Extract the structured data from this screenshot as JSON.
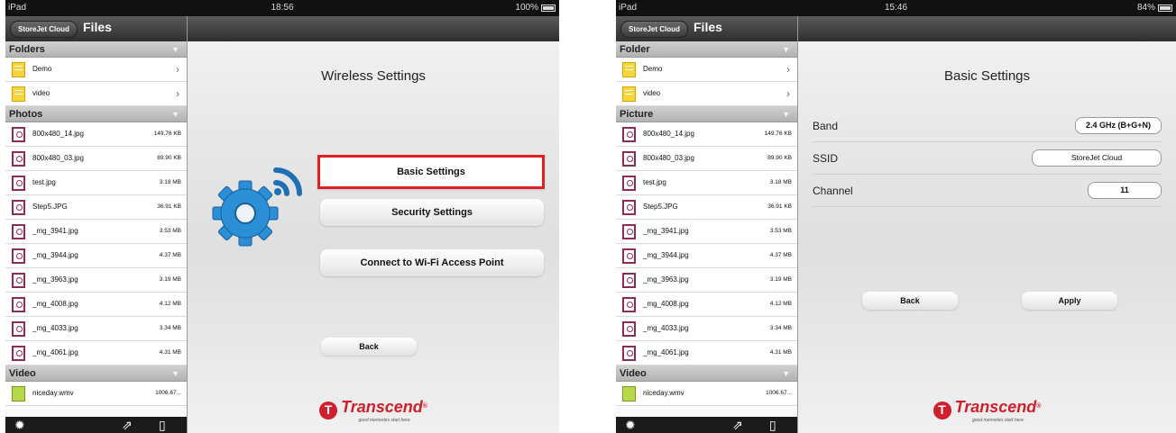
{
  "left": {
    "status": {
      "carrier": "iPad",
      "time": "18:56",
      "battery": "100%"
    },
    "sidebar": {
      "cloud_button": "StoreJet Cloud",
      "title": "Files",
      "folders_header": "Folders",
      "folders": [
        {
          "name": "Demo"
        },
        {
          "name": "video"
        }
      ],
      "photos_header": "Photos",
      "photos": [
        {
          "name": "800x480_14.jpg",
          "size": "149.76 KB"
        },
        {
          "name": "800x480_03.jpg",
          "size": "89.90 KB"
        },
        {
          "name": "test.jpg",
          "size": "3.18 MB"
        },
        {
          "name": "Step5.JPG",
          "size": "36.91 KB"
        },
        {
          "name": "_mg_3941.jpg",
          "size": "3.53 MB"
        },
        {
          "name": "_mg_3944.jpg",
          "size": "4.37 MB"
        },
        {
          "name": "_mg_3963.jpg",
          "size": "3.19 MB"
        },
        {
          "name": "_mg_4008.jpg",
          "size": "4.12 MB"
        },
        {
          "name": "_mg_4033.jpg",
          "size": "3.34 MB"
        },
        {
          "name": "_mg_4061.jpg",
          "size": "4.31 MB"
        }
      ],
      "video_header": "Video",
      "videos": [
        {
          "name": "niceday.wmv",
          "size": "1006.67..."
        }
      ]
    },
    "main": {
      "title": "Wireless Settings",
      "basic_settings": "Basic Settings",
      "security_settings": "Security Settings",
      "connect_wifi": "Connect to Wi-Fi Access Point",
      "back": "Back"
    }
  },
  "right": {
    "status": {
      "carrier": "iPad",
      "time": "15:46",
      "battery": "84%"
    },
    "sidebar": {
      "cloud_button": "StoreJet Cloud",
      "title": "Files",
      "folders_header": "Folder",
      "folders": [
        {
          "name": "Demo"
        },
        {
          "name": "video"
        }
      ],
      "photos_header": "Picture",
      "photos": [
        {
          "name": "800x480_14.jpg",
          "size": "149.76 KB"
        },
        {
          "name": "800x480_03.jpg",
          "size": "89.90 KB"
        },
        {
          "name": "test.jpg",
          "size": "3.18 MB"
        },
        {
          "name": "Step5.JPG",
          "size": "36.91 KB"
        },
        {
          "name": "_mg_3941.jpg",
          "size": "3.53 MB"
        },
        {
          "name": "_mg_3944.jpg",
          "size": "4.37 MB"
        },
        {
          "name": "_mg_3963.jpg",
          "size": "3.19 MB"
        },
        {
          "name": "_mg_4008.jpg",
          "size": "4.12 MB"
        },
        {
          "name": "_mg_4033.jpg",
          "size": "3.34 MB"
        },
        {
          "name": "_mg_4061.jpg",
          "size": "4.31 MB"
        }
      ],
      "video_header": "Video",
      "videos": [
        {
          "name": "niceday.wmv",
          "size": "1006.67..."
        }
      ]
    },
    "main": {
      "title": "Basic Settings",
      "band_label": "Band",
      "band_value": "2.4 GHz (B+G+N)",
      "ssid_label": "SSID",
      "ssid_value": "StoreJet Cloud",
      "channel_label": "Channel",
      "channel_value": "11",
      "back": "Back",
      "apply": "Apply"
    }
  },
  "brand": {
    "name": "Transcend",
    "tagline": "good memories start here"
  },
  "colors": {
    "brand_red": "#d01f2d",
    "highlight": "#e02020",
    "gear_blue": "#2a8fd4"
  },
  "icons": {
    "left_footer": "settings-gear-icon",
    "middle_footer": "export-icon",
    "right_footer": "device-icon",
    "folder": "folder-icon",
    "photo": "photo-icon",
    "video": "video-icon",
    "wireless_gear": "wireless-gear-icon"
  }
}
